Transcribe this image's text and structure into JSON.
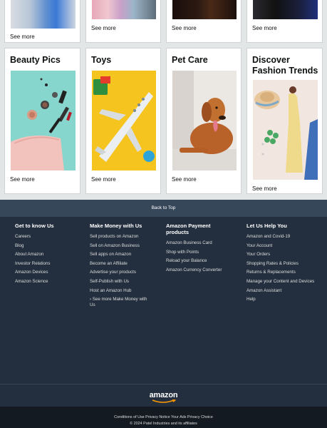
{
  "top_row_cards": [
    {
      "see_more": "See more"
    },
    {
      "see_more": "See more"
    },
    {
      "see_more": "See more"
    },
    {
      "see_more": "See more"
    }
  ],
  "cards": [
    {
      "title": "Beauty Pics",
      "see_more": "See more"
    },
    {
      "title": "Toys",
      "see_more": "See more"
    },
    {
      "title": "Pet Care",
      "see_more": "See more"
    },
    {
      "title": "Discover Fashion Trends",
      "see_more": "See more"
    }
  ],
  "footer": {
    "back_to_top": "Back to Top",
    "columns": [
      {
        "title": "Get to know Us",
        "links": [
          "Careers",
          "Blog",
          "About Amazon",
          "Investor Relations",
          "Amazon Devices",
          "Amazon Science"
        ]
      },
      {
        "title": "Make Money with Us",
        "links": [
          "Sell products on Amazon",
          "Sell on Amazon Business",
          "Sell apps on Amazon",
          "Become an Affiliate",
          "Advertise your products",
          "Self-Publish with Us",
          "Host an Amazon Hub",
          "› See more Make Money with Us"
        ]
      },
      {
        "title": "Amazon Payment products",
        "links": [
          "Amazon Business Card",
          "Shop with Points",
          "Reload your Balance",
          "Amazon Currency Converter"
        ]
      },
      {
        "title": "Let Us Help You",
        "links": [
          "Amazon and Covid-19",
          "Your Account",
          "Your Orders",
          "Shopping Rates & Policies",
          "Returns & Replacements",
          "Manage your Content and Devices",
          "Amazon Assistant",
          "Help"
        ]
      }
    ],
    "logo": "amazon",
    "legal_links": "Conditions of Use Privacy Notice Your Ads Privacy Choice",
    "copyright": "© 2024 Patel Industries and its affiliates"
  },
  "colors": {
    "page_bg": "#e3e6e6",
    "back_to_top_bg": "#37475a",
    "footer_bg": "#232f3e",
    "footer_bottom_bg": "#131a22",
    "logo_smile": "#ff9900"
  }
}
